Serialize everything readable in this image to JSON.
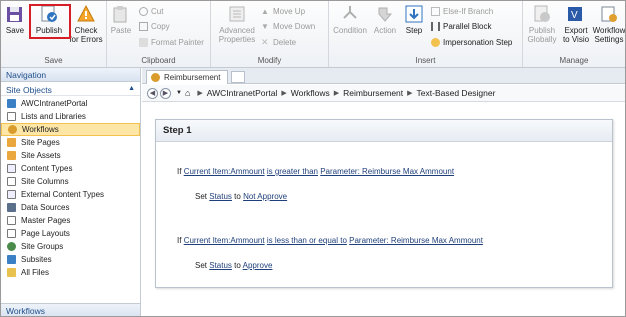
{
  "ribbon": {
    "groups": {
      "save": "Save",
      "clipboard": "Clipboard",
      "modify": "Modify",
      "insert": "Insert",
      "manage": "Manage"
    },
    "save_label": "Save",
    "publish_label": "Publish",
    "check_errors_line1": "Check",
    "check_errors_line2": "for Errors",
    "paste_label": "Paste",
    "cut_label": "Cut",
    "copy_label": "Copy",
    "format_painter_label": "Format Painter",
    "advanced_properties_line1": "Advanced",
    "advanced_properties_line2": "Properties",
    "move_up_label": "Move Up",
    "move_down_label": "Move Down",
    "delete_label": "Delete",
    "condition_label": "Condition",
    "action_label": "Action",
    "step_label": "Step",
    "else_if_label": "Else-If Branch",
    "parallel_label": "Parallel Block",
    "impersonation_label": "Impersonation Step",
    "publish_globally_line1": "Publish",
    "publish_globally_line2": "Globally",
    "export_visio_line1": "Export",
    "export_visio_line2": "to Visio",
    "workflow_settings_line1": "Workflow",
    "workflow_settings_line2": "Settings"
  },
  "nav": {
    "header": "Navigation",
    "section": "Site Objects",
    "items": [
      "AWCIntranetPortal",
      "Lists and Libraries",
      "Workflows",
      "Site Pages",
      "Site Assets",
      "Content Types",
      "Site Columns",
      "External Content Types",
      "Data Sources",
      "Master Pages",
      "Page Layouts",
      "Site Groups",
      "Subsites",
      "All Files"
    ],
    "footer": "Workflows"
  },
  "tab": {
    "label": "Reimbursement"
  },
  "breadcrumb": [
    "AWCIntranetPortal",
    "Workflows",
    "Reimbursement",
    "Text-Based Designer"
  ],
  "step": {
    "title": "Step 1",
    "rule1": {
      "if": "If",
      "field": "Current Item:Ammount",
      "op": "is greater than",
      "param": "Parameter: Reimburse Max Ammount",
      "set": "Set",
      "status": "Status",
      "to": "to",
      "value": "Not Approve"
    },
    "rule2": {
      "if": "If",
      "field": "Current Item:Ammount",
      "op": "is less than or equal to",
      "param": "Parameter: Reimburse Max Ammount",
      "set": "Set",
      "status": "Status",
      "to": "to",
      "value": "Approve"
    }
  },
  "colors": {
    "highlight": "#d71e26",
    "selected": "#fde6a6",
    "link": "#1f3f7a",
    "nav_text": "#1e4e8c"
  }
}
